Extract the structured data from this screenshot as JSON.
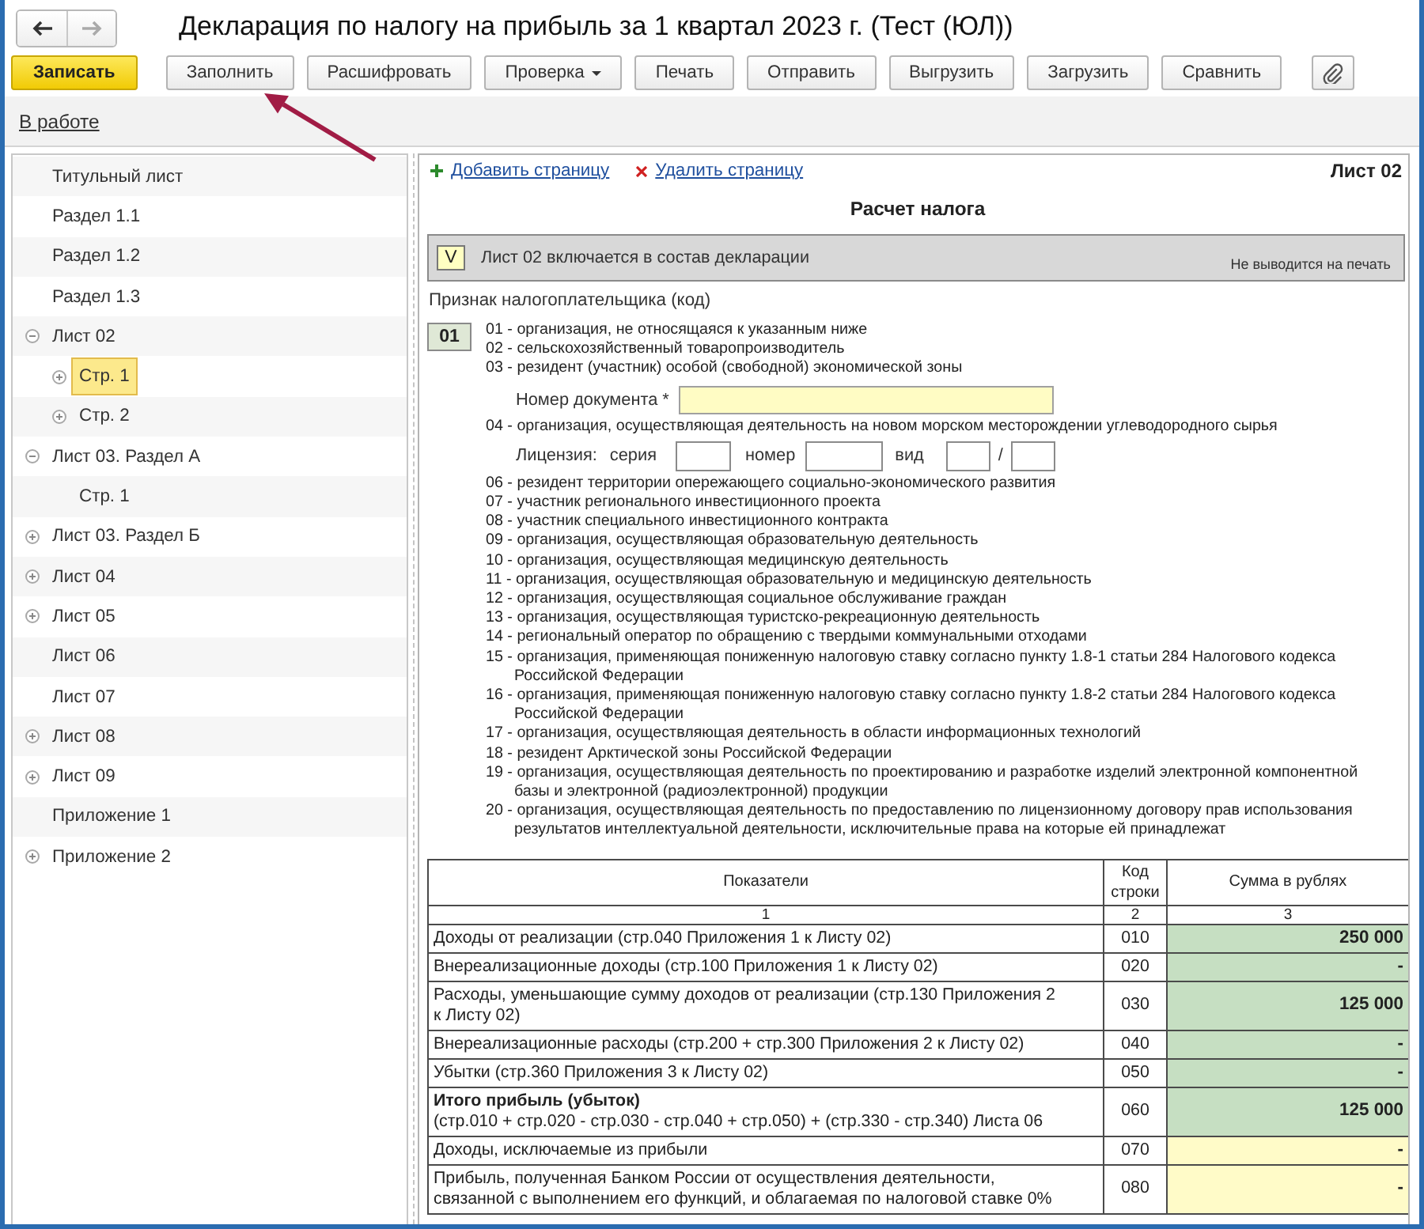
{
  "window": {
    "title": "Декларация по налогу на прибыль за 1 квартал 2023 г. (Тест (ЮЛ))"
  },
  "navigation": {
    "back": {
      "disabled": false
    },
    "forward": {
      "disabled": true
    }
  },
  "toolbar": {
    "buttons": [
      {
        "label": "Записать",
        "kind": "primary"
      },
      {
        "label": "Заполнить",
        "kind": "plain"
      },
      {
        "label": "Расшифровать",
        "kind": "plain"
      },
      {
        "label": "Проверка",
        "kind": "dropdown"
      },
      {
        "label": "Печать",
        "kind": "plain"
      },
      {
        "label": "Отправить",
        "kind": "plain"
      },
      {
        "label": "Выгрузить",
        "kind": "plain"
      },
      {
        "label": "Загрузить",
        "kind": "plain"
      },
      {
        "label": "Сравнить",
        "kind": "plain"
      }
    ]
  },
  "status": {
    "link": "В работе"
  },
  "sidebar": {
    "items": [
      {
        "label": "Титульный лист",
        "selected": false
      },
      {
        "label": "Раздел 1.1",
        "selected": false
      },
      {
        "label": "Раздел 1.2",
        "selected": false
      },
      {
        "label": "Раздел 1.3",
        "selected": false
      },
      {
        "label": "Лист 02",
        "expanded": true,
        "selected": false,
        "children": [
          {
            "label": "Стр. 1",
            "expanded": false,
            "selected": true
          },
          {
            "label": "Стр. 2",
            "expanded": false,
            "selected": false
          }
        ]
      },
      {
        "label": "Лист 03. Раздел А",
        "expanded": true,
        "selected": false,
        "children": [
          {
            "label": "Стр. 1",
            "selected": false
          }
        ]
      },
      {
        "label": "Лист 03. Раздел Б",
        "expanded": false,
        "selected": false
      },
      {
        "label": "Лист 04",
        "expanded": false,
        "selected": false
      },
      {
        "label": "Лист 05",
        "expanded": false,
        "selected": false
      },
      {
        "label": "Лист 06",
        "selected": false
      },
      {
        "label": "Лист 07",
        "selected": false
      },
      {
        "label": "Лист 08",
        "expanded": false,
        "selected": false
      },
      {
        "label": "Лист 09",
        "expanded": false,
        "selected": false
      },
      {
        "label": "Приложение 1",
        "selected": false
      },
      {
        "label": "Приложение 2",
        "expanded": false,
        "selected": false
      }
    ]
  },
  "sheet": {
    "add_link": "Добавить страницу",
    "delete_link": "Удалить страницу",
    "sheet_number": "Лист 02",
    "heading": "Расчет налога",
    "include": {
      "checked": true,
      "mark": "V",
      "label": "Лист 02 включается в состав декларации",
      "note": "Не выводится на печать"
    },
    "taxpayer_sign": {
      "label": "Признак налогоплательщика (код)",
      "code": "01",
      "options": [
        {
          "text": "01 - организация, не относящаяся к указанным ниже"
        },
        {
          "text": "02 - сельскохозяйственный товаропроизводитель"
        },
        {
          "text": "03 - резидент (участник) особой (свободной) экономической зоны",
          "document_number": {
            "label": "Номер документа *"
          }
        },
        {
          "text": "04 - организация, осуществляющая деятельность на новом морском месторождении углеводородного сырья",
          "license": {
            "label": "Лицензия:",
            "series_label": "серия",
            "number_label": "номер",
            "kind_label": "вид",
            "separator": "/"
          }
        },
        {
          "text": "06 - резидент территории опережающего социально-экономического развития"
        },
        {
          "text": "07 - участник регионального инвестиционного проекта"
        },
        {
          "text": "08 - участник специального инвестиционного контракта"
        },
        {
          "text": "09 - организация, осуществляющая образовательную деятельность"
        },
        {
          "text": "10 - организация, осуществляющая медицинскую деятельность"
        },
        {
          "text": "11 - организация, осуществляющая образовательную и медицинскую деятельность"
        },
        {
          "text": "12 - организация, осуществляющая социальное обслуживание граждан"
        },
        {
          "text": "13 - организация, осуществляющая туристско-рекреационную деятельность"
        },
        {
          "text": "14 - региональный оператор по обращению с твердыми коммунальными отходами"
        },
        {
          "text": "15 - организация, применяющая пониженную налоговую ставку согласно пункту 1.8-1 статьи 284 Налогового кодекса Российской Федерации"
        },
        {
          "text": "16 - организация, применяющая пониженную налоговую ставку согласно пункту 1.8-2 статьи 284 Налогового кодекса Российской Федерации"
        },
        {
          "text": "17 - организация, осуществляющая деятельность в области информационных технологий"
        },
        {
          "text": "18 - резидент Арктической зоны Российской Федерации"
        },
        {
          "text": "19 - организация, осуществляющая деятельность по проектированию и разработке изделий электронной компонентной базы и электронной (радиоэлектронной) продукции"
        },
        {
          "text": "20 - организация, осуществляющая деятельность по предоставлению по лицензионному договору прав использования результатов интеллектуальной деятельности, исключительные права на которые ей принадлежат"
        }
      ]
    },
    "table": {
      "columns": [
        "Показатели",
        "Код строки",
        "Сумма в рублях"
      ],
      "column_numbers": [
        "1",
        "2",
        "3"
      ],
      "rows": [
        {
          "label": "Доходы от реализации (стр.040 Приложения 1 к Листу 02)",
          "code": "010",
          "value": "250 000",
          "kind": "calculated"
        },
        {
          "label": "Внереализационные доходы (стр.100 Приложения 1 к Листу 02)",
          "code": "020",
          "value": "-",
          "kind": "calculated"
        },
        {
          "label": "Расходы, уменьшающие сумму доходов от реализации (стр.130 Приложения 2 к Листу 02)",
          "code": "030",
          "value": "125 000",
          "kind": "calculated"
        },
        {
          "label": "Внереализационные расходы (стр.200 + стр.300 Приложения 2 к Листу 02)",
          "code": "040",
          "value": "-",
          "kind": "calculated"
        },
        {
          "label": "Убытки (стр.360 Приложения 3 к Листу 02)",
          "code": "050",
          "value": "-",
          "kind": "calculated"
        },
        {
          "label": "**Итого прибыль (убыток)**\n(стр.010 + стр.020 - стр.030 - стр.040 + стр.050) + (стр.330 - стр.340) Листа 06",
          "code": "060",
          "value": "125 000",
          "kind": "calculated"
        },
        {
          "label": "Доходы, исключаемые из прибыли",
          "code": "070",
          "value": "-",
          "kind": "input"
        },
        {
          "label": "Прибыль, полученная Банком России от осуществления деятельности, связанной с выполнением его функций, и облагаемая по налоговой ставке 0%",
          "code": "080",
          "value": "-",
          "kind": "input"
        }
      ]
    }
  }
}
